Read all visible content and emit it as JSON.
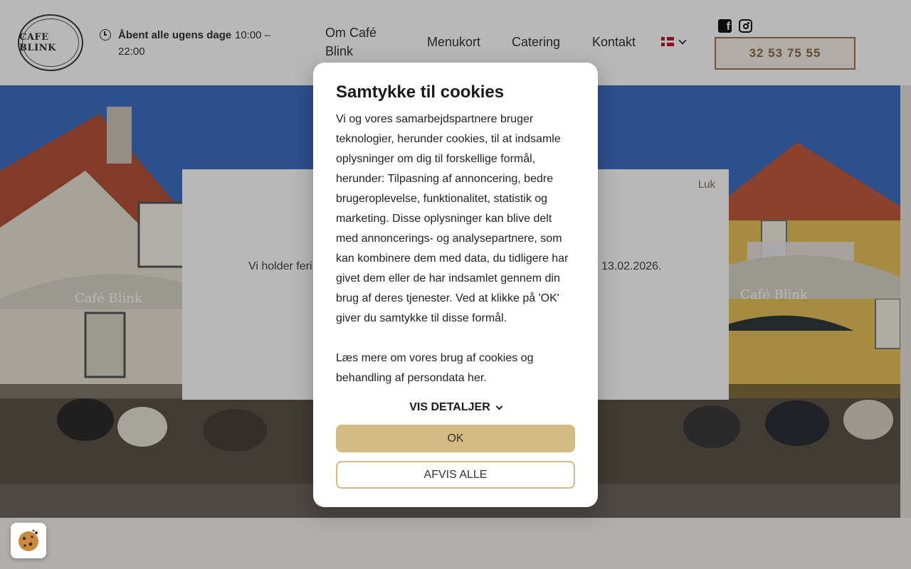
{
  "header": {
    "logo_text": "CAFE BLINK",
    "hours_label": "Åbent alle ugens dage",
    "hours_time": "10:00 – 22:00",
    "nav": {
      "about": "Om Café Blink",
      "menu": "Menukort",
      "catering": "Catering",
      "contact": "Kontakt"
    },
    "language": "Dansk",
    "phone": "32 53 75 55"
  },
  "hero": {
    "umbrella_text_left": "Café Blink",
    "umbrella_text_right": "Café Blink"
  },
  "notice": {
    "close_label": "Luk",
    "message_start": "Vi holder feri",
    "message_end": "13.02.2026."
  },
  "cookie_dialog": {
    "title": "Samtykke til cookies",
    "body": "Vi og vores samarbejdspartnere bruger teknologier, herunder cookies, til at indsamle oplysninger om dig til forskellige formål, herunder: Tilpasning af annoncering, bedre brugeroplevelse, funktionalitet, statistik og marketing. Disse oplysninger kan blive delt med annoncerings- og analysepartnere, som kan kombinere dem med data, du tidligere har givet dem eller de har indsamlet gennem din brug af deres tjenester. Ved at klikke på 'OK' giver du samtykke til disse formål.",
    "more_info": "Læs mere om vores brug af cookies og behandling af persondata her.",
    "details_label": "VIS DETALJER",
    "ok_label": "OK",
    "reject_label": "AFVIS ALLE"
  },
  "colors": {
    "accent": "#d4bb84",
    "phone_border": "#a07850",
    "sky": "#3f6fc2"
  }
}
